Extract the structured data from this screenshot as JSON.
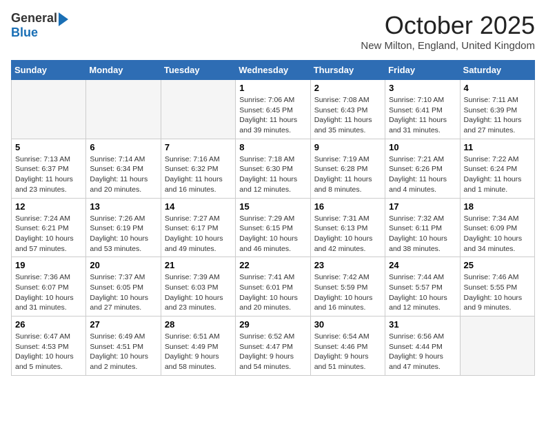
{
  "header": {
    "logo_general": "General",
    "logo_blue": "Blue",
    "month": "October 2025",
    "location": "New Milton, England, United Kingdom"
  },
  "days_of_week": [
    "Sunday",
    "Monday",
    "Tuesday",
    "Wednesday",
    "Thursday",
    "Friday",
    "Saturday"
  ],
  "weeks": [
    [
      {
        "day": "",
        "info": ""
      },
      {
        "day": "",
        "info": ""
      },
      {
        "day": "",
        "info": ""
      },
      {
        "day": "1",
        "info": "Sunrise: 7:06 AM\nSunset: 6:45 PM\nDaylight: 11 hours\nand 39 minutes."
      },
      {
        "day": "2",
        "info": "Sunrise: 7:08 AM\nSunset: 6:43 PM\nDaylight: 11 hours\nand 35 minutes."
      },
      {
        "day": "3",
        "info": "Sunrise: 7:10 AM\nSunset: 6:41 PM\nDaylight: 11 hours\nand 31 minutes."
      },
      {
        "day": "4",
        "info": "Sunrise: 7:11 AM\nSunset: 6:39 PM\nDaylight: 11 hours\nand 27 minutes."
      }
    ],
    [
      {
        "day": "5",
        "info": "Sunrise: 7:13 AM\nSunset: 6:37 PM\nDaylight: 11 hours\nand 23 minutes."
      },
      {
        "day": "6",
        "info": "Sunrise: 7:14 AM\nSunset: 6:34 PM\nDaylight: 11 hours\nand 20 minutes."
      },
      {
        "day": "7",
        "info": "Sunrise: 7:16 AM\nSunset: 6:32 PM\nDaylight: 11 hours\nand 16 minutes."
      },
      {
        "day": "8",
        "info": "Sunrise: 7:18 AM\nSunset: 6:30 PM\nDaylight: 11 hours\nand 12 minutes."
      },
      {
        "day": "9",
        "info": "Sunrise: 7:19 AM\nSunset: 6:28 PM\nDaylight: 11 hours\nand 8 minutes."
      },
      {
        "day": "10",
        "info": "Sunrise: 7:21 AM\nSunset: 6:26 PM\nDaylight: 11 hours\nand 4 minutes."
      },
      {
        "day": "11",
        "info": "Sunrise: 7:22 AM\nSunset: 6:24 PM\nDaylight: 11 hours\nand 1 minute."
      }
    ],
    [
      {
        "day": "12",
        "info": "Sunrise: 7:24 AM\nSunset: 6:21 PM\nDaylight: 10 hours\nand 57 minutes."
      },
      {
        "day": "13",
        "info": "Sunrise: 7:26 AM\nSunset: 6:19 PM\nDaylight: 10 hours\nand 53 minutes."
      },
      {
        "day": "14",
        "info": "Sunrise: 7:27 AM\nSunset: 6:17 PM\nDaylight: 10 hours\nand 49 minutes."
      },
      {
        "day": "15",
        "info": "Sunrise: 7:29 AM\nSunset: 6:15 PM\nDaylight: 10 hours\nand 46 minutes."
      },
      {
        "day": "16",
        "info": "Sunrise: 7:31 AM\nSunset: 6:13 PM\nDaylight: 10 hours\nand 42 minutes."
      },
      {
        "day": "17",
        "info": "Sunrise: 7:32 AM\nSunset: 6:11 PM\nDaylight: 10 hours\nand 38 minutes."
      },
      {
        "day": "18",
        "info": "Sunrise: 7:34 AM\nSunset: 6:09 PM\nDaylight: 10 hours\nand 34 minutes."
      }
    ],
    [
      {
        "day": "19",
        "info": "Sunrise: 7:36 AM\nSunset: 6:07 PM\nDaylight: 10 hours\nand 31 minutes."
      },
      {
        "day": "20",
        "info": "Sunrise: 7:37 AM\nSunset: 6:05 PM\nDaylight: 10 hours\nand 27 minutes."
      },
      {
        "day": "21",
        "info": "Sunrise: 7:39 AM\nSunset: 6:03 PM\nDaylight: 10 hours\nand 23 minutes."
      },
      {
        "day": "22",
        "info": "Sunrise: 7:41 AM\nSunset: 6:01 PM\nDaylight: 10 hours\nand 20 minutes."
      },
      {
        "day": "23",
        "info": "Sunrise: 7:42 AM\nSunset: 5:59 PM\nDaylight: 10 hours\nand 16 minutes."
      },
      {
        "day": "24",
        "info": "Sunrise: 7:44 AM\nSunset: 5:57 PM\nDaylight: 10 hours\nand 12 minutes."
      },
      {
        "day": "25",
        "info": "Sunrise: 7:46 AM\nSunset: 5:55 PM\nDaylight: 10 hours\nand 9 minutes."
      }
    ],
    [
      {
        "day": "26",
        "info": "Sunrise: 6:47 AM\nSunset: 4:53 PM\nDaylight: 10 hours\nand 5 minutes."
      },
      {
        "day": "27",
        "info": "Sunrise: 6:49 AM\nSunset: 4:51 PM\nDaylight: 10 hours\nand 2 minutes."
      },
      {
        "day": "28",
        "info": "Sunrise: 6:51 AM\nSunset: 4:49 PM\nDaylight: 9 hours\nand 58 minutes."
      },
      {
        "day": "29",
        "info": "Sunrise: 6:52 AM\nSunset: 4:47 PM\nDaylight: 9 hours\nand 54 minutes."
      },
      {
        "day": "30",
        "info": "Sunrise: 6:54 AM\nSunset: 4:46 PM\nDaylight: 9 hours\nand 51 minutes."
      },
      {
        "day": "31",
        "info": "Sunrise: 6:56 AM\nSunset: 4:44 PM\nDaylight: 9 hours\nand 47 minutes."
      },
      {
        "day": "",
        "info": ""
      }
    ]
  ]
}
